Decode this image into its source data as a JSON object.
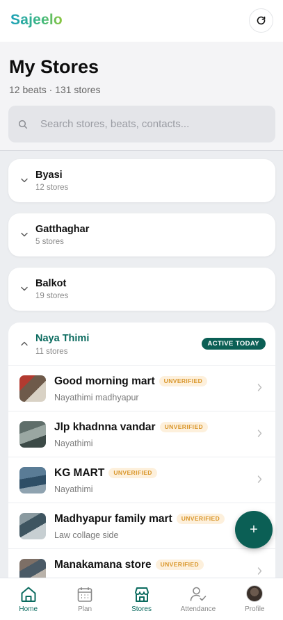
{
  "app": {
    "logo_text": "Sajeelo",
    "accent_color": "#0b5f55"
  },
  "header": {
    "title": "My Stores",
    "subtitle": "12 beats · 131 stores",
    "search_placeholder": "Search stores, beats, contacts..."
  },
  "beats": [
    {
      "name": "Byasi",
      "count": "12 stores"
    },
    {
      "name": "Gatthaghar",
      "count": "5 stores"
    },
    {
      "name": "Balkot",
      "count": "19 stores"
    }
  ],
  "open_beat": {
    "name": "Naya Thimi",
    "count": "11 stores",
    "badge": "ACTIVE TODAY",
    "stores": [
      {
        "name": "Good morning mart",
        "badge": "UNVERIFIED",
        "address": "Nayathimi madhyapur"
      },
      {
        "name": "Jlp khadnna vandar",
        "badge": "UNVERIFIED",
        "address": "Nayathimi"
      },
      {
        "name": "KG MART",
        "badge": "UNVERIFIED",
        "address": "Nayathimi"
      },
      {
        "name": "Madhyapur family mart",
        "badge": "UNVERIFIED",
        "address": "Law collage side"
      },
      {
        "name": "Manakamana store",
        "badge": "UNVERIFIED",
        "address": ""
      }
    ]
  },
  "fab": {
    "label": "+"
  },
  "nav": [
    {
      "label": "Home",
      "icon": "home-icon",
      "active": true
    },
    {
      "label": "Plan",
      "icon": "calendar-icon",
      "active": false
    },
    {
      "label": "Stores",
      "icon": "store-icon",
      "active": true
    },
    {
      "label": "Attendance",
      "icon": "person-check-icon",
      "active": false
    },
    {
      "label": "Profile",
      "icon": "avatar",
      "active": false
    }
  ]
}
